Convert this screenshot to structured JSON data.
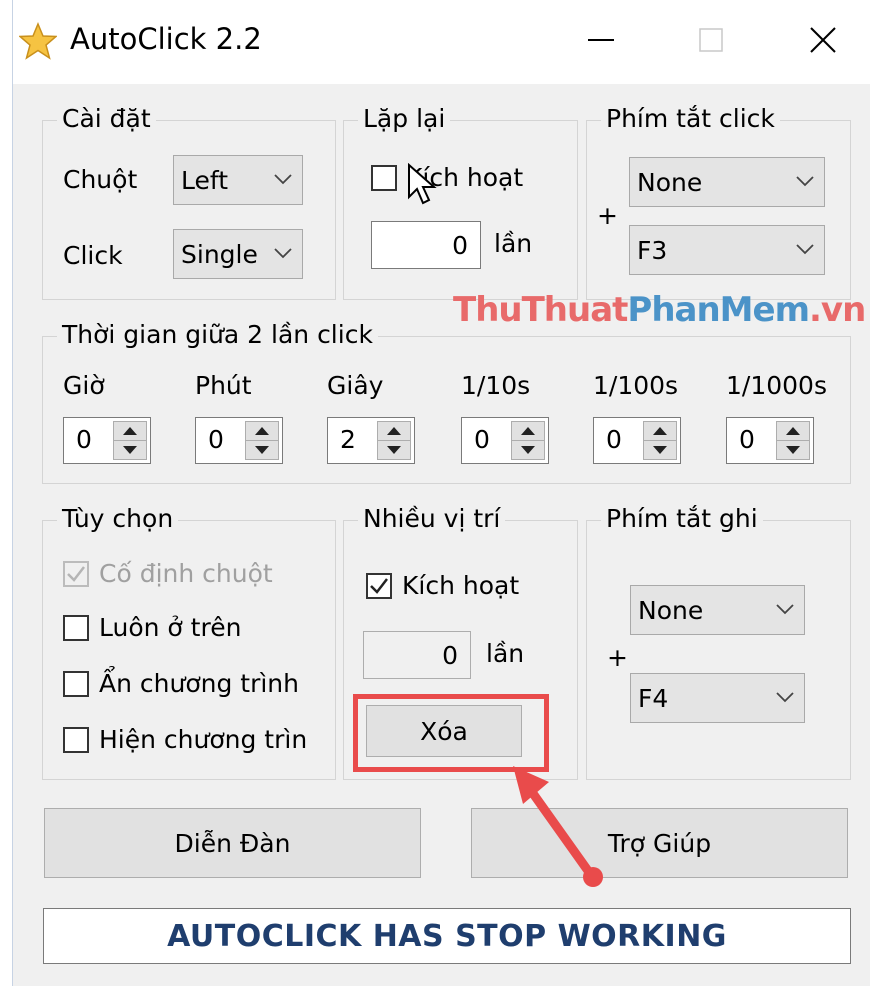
{
  "window": {
    "title": "AutoClick 2.2",
    "buttons": {
      "minimize": "minimize-icon",
      "maximize": "maximize-icon",
      "close": "close-icon"
    }
  },
  "caidat": {
    "legend": "Cài đặt",
    "chuot_label": "Chuột",
    "chuot_value": "Left",
    "click_label": "Click",
    "click_value": "Single"
  },
  "laplai": {
    "legend": "Lặp lại",
    "checkbox_label": "Kích hoạt",
    "checked": false,
    "count": "0",
    "unit": "lần"
  },
  "phimtat_click": {
    "legend": "Phím tắt click",
    "plus": "+",
    "modifier": "None",
    "key": "F3"
  },
  "watermark": {
    "part1": "ThuThuat",
    "part2": "PhanMem",
    "part3": ".vn"
  },
  "thoigian": {
    "legend": "Thời gian giữa 2 lần click",
    "fields": [
      {
        "label": "Giờ",
        "value": "0"
      },
      {
        "label": "Phút",
        "value": "0"
      },
      {
        "label": "Giây",
        "value": "2"
      },
      {
        "label": "1/10s",
        "value": "0"
      },
      {
        "label": "1/100s",
        "value": "0"
      },
      {
        "label": "1/1000s",
        "value": "0"
      }
    ]
  },
  "tuychon": {
    "legend": "Tùy chọn",
    "options": [
      {
        "label": "Cố định chuột",
        "checked": true,
        "disabled": true
      },
      {
        "label": "Luôn ở trên",
        "checked": false,
        "disabled": false
      },
      {
        "label": "Ẩn chương trình",
        "checked": false,
        "disabled": false
      },
      {
        "label": "Hiện chương trìn",
        "checked": false,
        "disabled": false
      }
    ]
  },
  "nhieuvitri": {
    "legend": "Nhiều vị trí",
    "checkbox_label": "Kích hoạt",
    "checked": true,
    "count": "0",
    "unit": "lần",
    "clear_button": "Xóa"
  },
  "phimtat_ghi": {
    "legend": "Phím tắt ghi",
    "plus": "+",
    "modifier": "None",
    "key": "F4"
  },
  "footer": {
    "forum_button": "Diễn Đàn",
    "help_button": "Trợ Giúp",
    "status": "AUTOCLICK HAS STOP WORKING"
  },
  "colors": {
    "highlight": "#e94b4b",
    "status_text": "#1f3e6e",
    "window_bg": "#f0f0f0"
  }
}
